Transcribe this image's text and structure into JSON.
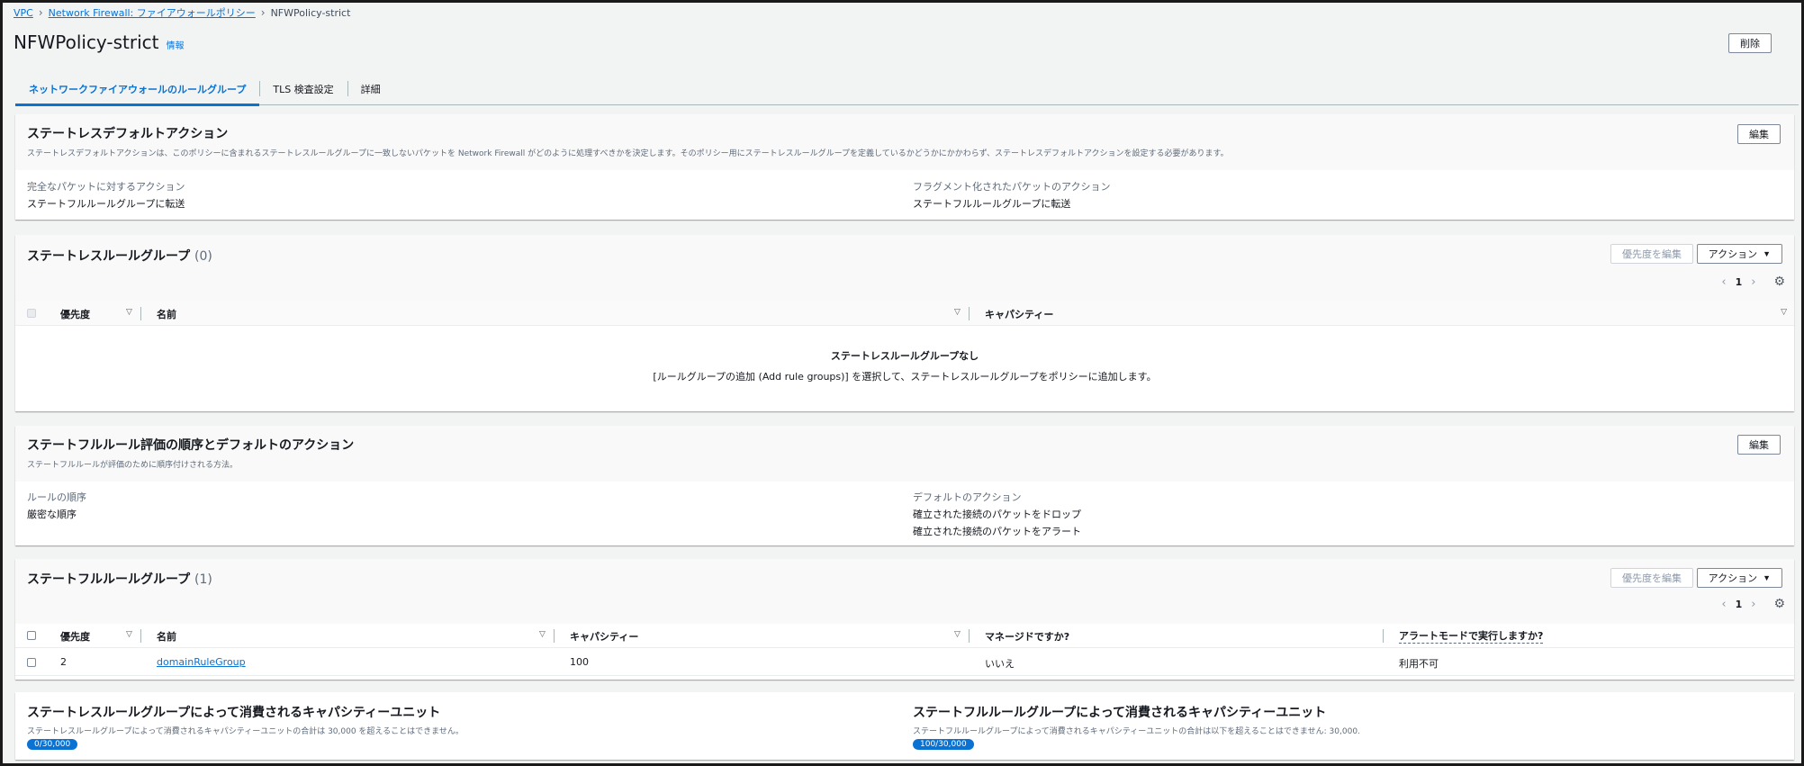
{
  "breadcrumb": {
    "items": [
      "VPC",
      "Network Firewall: ファイアウォールポリシー"
    ],
    "current": "NFWPolicy-strict"
  },
  "page": {
    "title": "NFWPolicy-strict",
    "info": "情報",
    "delete_label": "削除"
  },
  "tabs": [
    {
      "label": "ネットワークファイアウォールのルールグループ",
      "active": true
    },
    {
      "label": "TLS 検査設定",
      "active": false
    },
    {
      "label": "詳細",
      "active": false
    }
  ],
  "stateless_default": {
    "title": "ステートレスデフォルトアクション",
    "description": "ステートレスデフォルトアクションは、このポリシーに含まれるステートレスルールグループに一致しないパケットを Network Firewall がどのように処理すべきかを決定します。そのポリシー用にステートレスルールグループを定義しているかどうかにかかわらず、ステートレスデフォルトアクションを設定する必要があります。",
    "edit_label": "編集",
    "full_packet_label": "完全なパケットに対するアクション",
    "full_packet_value": "ステートフルルールグループに転送",
    "fragment_label": "フラグメント化されたパケットのアクション",
    "fragment_value": "ステートフルルールグループに転送"
  },
  "stateless_groups": {
    "title": "ステートレスルールグループ",
    "count": "(0)",
    "edit_priority_label": "優先度を編集",
    "actions_label": "アクション",
    "page": "1",
    "columns": [
      "優先度",
      "名前",
      "キャパシティー"
    ],
    "empty_title": "ステートレスルールグループなし",
    "empty_desc": "[ルールグループの追加 (Add rule groups)] を選択して、ステートレスルールグループをポリシーに追加します。"
  },
  "stateful_order": {
    "title": "ステートフルルール評価の順序とデフォルトのアクション",
    "description": "ステートフルルールが評価のために順序付けされる方法。",
    "edit_label": "編集",
    "rule_order_label": "ルールの順序",
    "rule_order_value": "厳密な順序",
    "default_action_label": "デフォルトのアクション",
    "default_action_values": [
      "確立された接続のパケットをドロップ",
      "確立された接続のパケットをアラート"
    ]
  },
  "stateful_groups": {
    "title": "ステートフルルールグループ",
    "count": "(1)",
    "edit_priority_label": "優先度を編集",
    "actions_label": "アクション",
    "page": "1",
    "columns": [
      "優先度",
      "名前",
      "キャパシティー",
      "マネージドですか?",
      "アラートモードで実行しますか?"
    ],
    "rows": [
      {
        "priority": "2",
        "name": "domainRuleGroup",
        "capacity": "100",
        "managed": "いいえ",
        "alert_mode": "利用不可"
      }
    ]
  },
  "capacity": {
    "stateless_title": "ステートレスルールグループによって消費されるキャパシティーユニット",
    "stateless_desc": "ステートレスルールグループによって消費されるキャパシティーユニットの合計は 30,000 を超えることはできません。",
    "stateless_badge": "0/30,000",
    "stateful_title": "ステートフルルールグループによって消費されるキャパシティーユニット",
    "stateful_desc": "ステートフルルールグループによって消費されるキャパシティーユニットの合計は以下を超えることはできません: 30,000.",
    "stateful_badge": "100/30,000"
  }
}
